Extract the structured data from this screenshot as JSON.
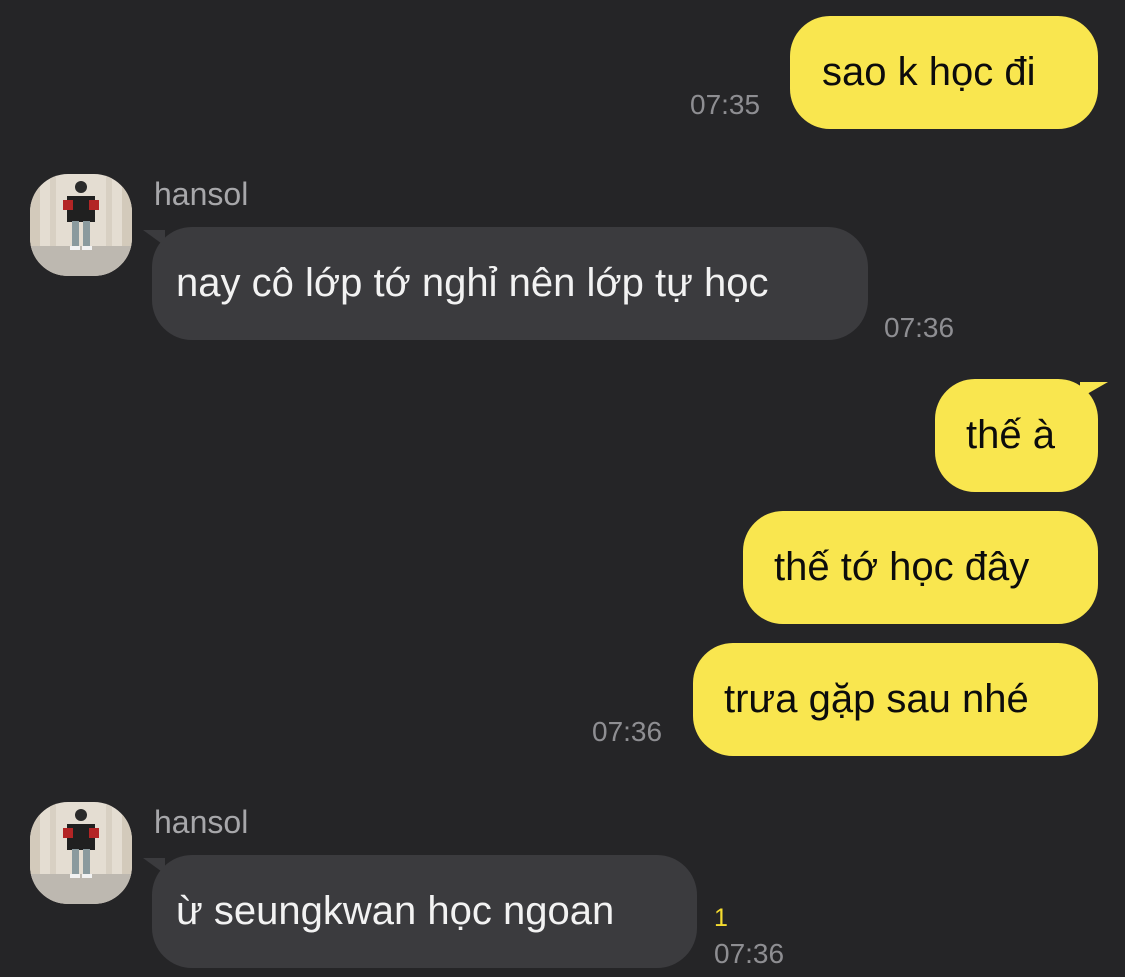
{
  "chat": {
    "messages": [
      {
        "id": "m1",
        "from": "me",
        "text": "sao k học đi",
        "time": "07:35"
      },
      {
        "id": "m2",
        "from": "hansol",
        "sender": "hansol",
        "text": "nay cô lớp tớ nghỉ nên lớp tự học",
        "time": "07:36"
      },
      {
        "id": "m3",
        "from": "me",
        "text": "thế à"
      },
      {
        "id": "m4",
        "from": "me",
        "text": "thế tớ học đây"
      },
      {
        "id": "m5",
        "from": "me",
        "text": "trưa gặp sau nhé",
        "time": "07:36"
      },
      {
        "id": "m6",
        "from": "hansol",
        "sender": "hansol",
        "text": "ừ seungkwan học ngoan",
        "time": "07:36",
        "unread": "1"
      }
    ]
  },
  "colors": {
    "background": "#252527",
    "my_bubble": "#f9e64f",
    "their_bubble": "#3b3b3e",
    "timestamp": "#8e8e92",
    "unread_badge": "#f5dc2f"
  },
  "icons": {
    "avatar": "profile-photo"
  }
}
